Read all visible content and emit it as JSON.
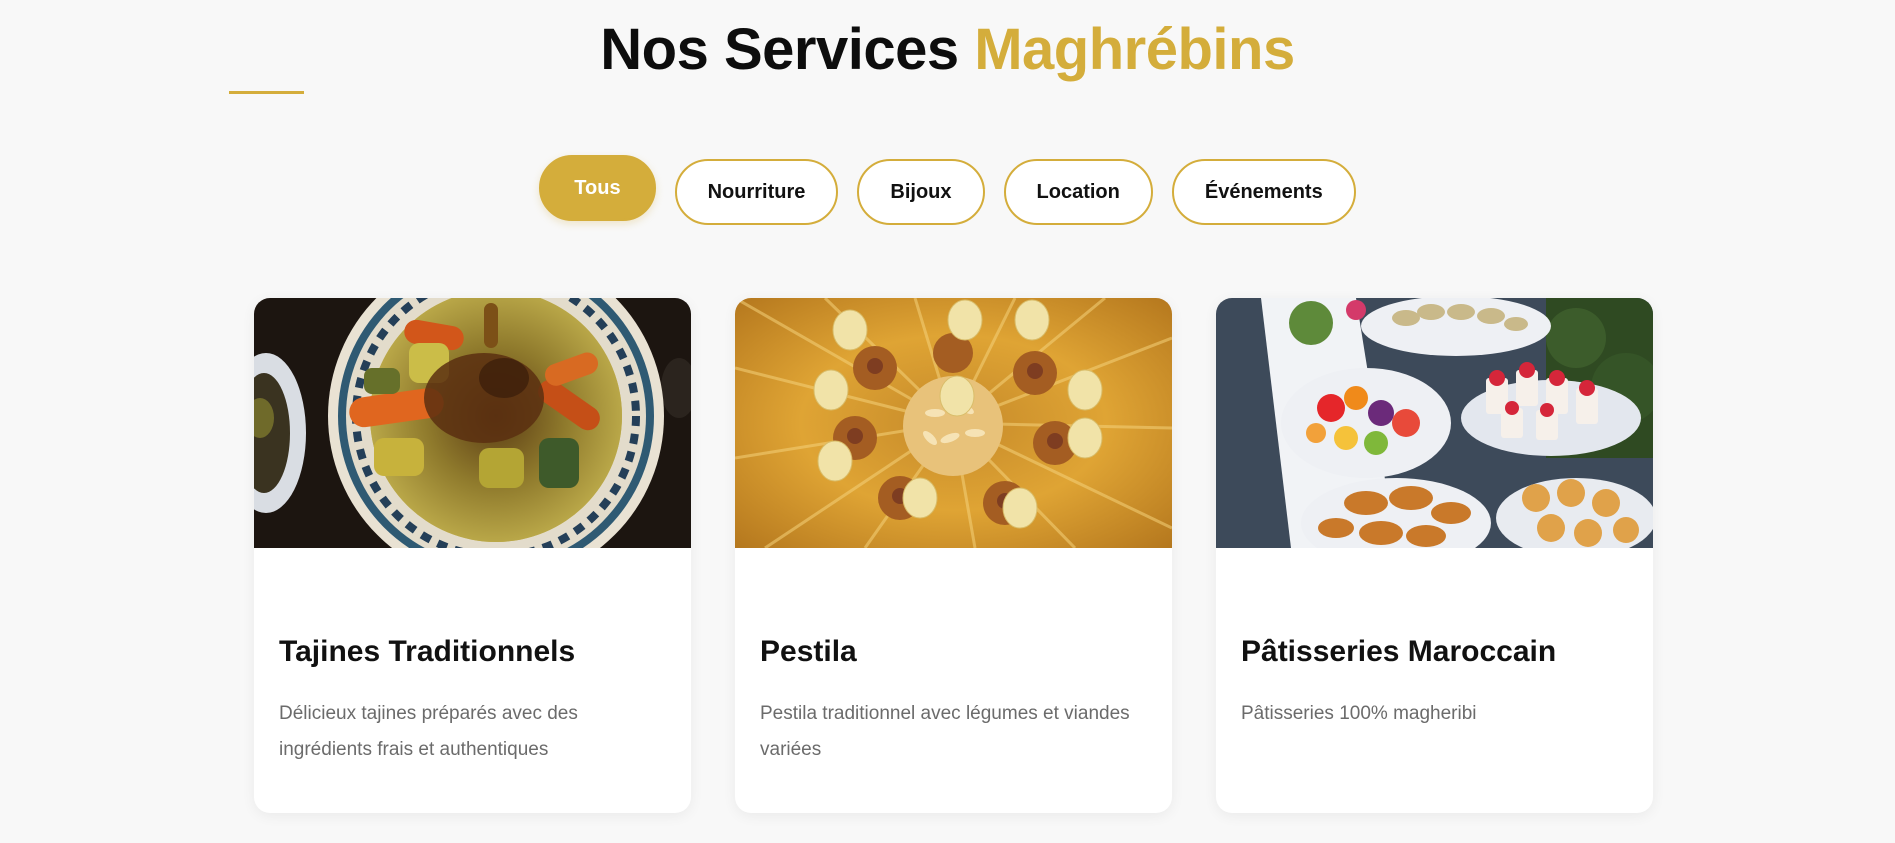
{
  "header": {
    "title_main": "Nos Services",
    "title_accent": "Maghrébins"
  },
  "filters": [
    {
      "label": "Tous",
      "active": true
    },
    {
      "label": "Nourriture",
      "active": false
    },
    {
      "label": "Bijoux",
      "active": false
    },
    {
      "label": "Location",
      "active": false
    },
    {
      "label": "Événements",
      "active": false
    }
  ],
  "services": [
    {
      "title": "Tajines Traditionnels",
      "description": "Délicieux tajines préparés avec des ingrédients frais et authentiques",
      "image": "tajine-photo"
    },
    {
      "title": "Pestila",
      "description": "Pestila traditionnel avec légumes et viandes variées",
      "image": "pastilla-photo"
    },
    {
      "title": "Pâtisseries Maroccain",
      "description": "Pâtisseries 100% magheribi",
      "image": "pastry-buffet-photo"
    }
  ],
  "colors": {
    "accent": "#d4ad3b",
    "background": "#f8f8f8",
    "text": "#111111",
    "muted": "#6b6b6b"
  }
}
